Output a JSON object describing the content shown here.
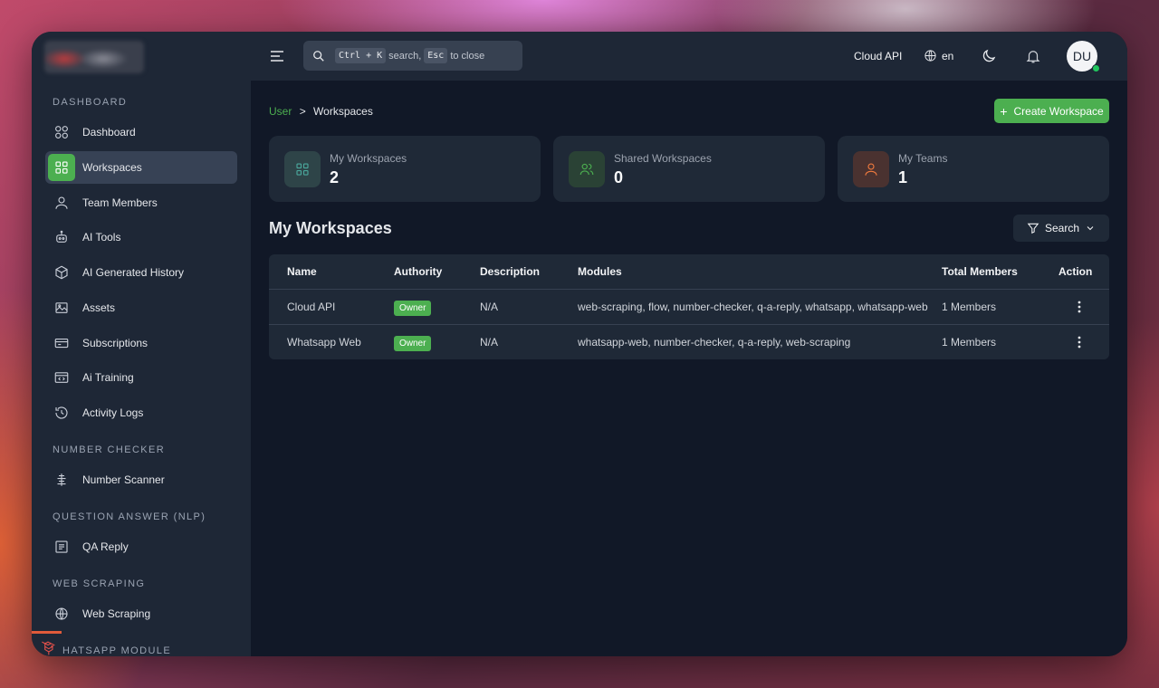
{
  "colors": {
    "accent": "#4caf50",
    "sidebar_bg": "#1e2736",
    "content_bg": "#111827",
    "card_bg": "#1f2937"
  },
  "sidebar": {
    "sections": [
      {
        "title": "DASHBOARD"
      },
      {
        "title": "NUMBER CHECKER"
      },
      {
        "title": "QUESTION ANSWER (NLP)"
      },
      {
        "title": "WEB SCRAPING"
      },
      {
        "title": "HATSAPP MODULE"
      }
    ],
    "items": [
      {
        "label": "Dashboard",
        "icon": "dashboard-icon"
      },
      {
        "label": "Workspaces",
        "icon": "grid-icon",
        "active": true
      },
      {
        "label": "Team Members",
        "icon": "user-icon"
      },
      {
        "label": "AI Tools",
        "icon": "robot-icon"
      },
      {
        "label": "AI Generated History",
        "icon": "cube-icon"
      },
      {
        "label": "Assets",
        "icon": "image-icon"
      },
      {
        "label": "Subscriptions",
        "icon": "card-icon"
      },
      {
        "label": "Ai Training",
        "icon": "code-window-icon"
      },
      {
        "label": "Activity Logs",
        "icon": "history-icon"
      },
      {
        "label": "Number Scanner",
        "icon": "scanner-icon"
      },
      {
        "label": "QA Reply",
        "icon": "document-icon"
      },
      {
        "label": "Web Scraping",
        "icon": "globe-icon"
      }
    ]
  },
  "topbar": {
    "search": {
      "kbd1": "Ctrl + K",
      "text1": "search,",
      "kbd2": "Esc",
      "text2": "to close"
    },
    "workspace": "Cloud API",
    "language": "en",
    "avatar_initials": "DU"
  },
  "breadcrumb": {
    "parent": "User",
    "separator": ">",
    "current": "Workspaces"
  },
  "create_button": {
    "plus": "+",
    "label": "Create Workspace"
  },
  "stats": [
    {
      "label": "My Workspaces",
      "value": "2",
      "icon": "grid-icon",
      "color": "#4aa89c"
    },
    {
      "label": "Shared Workspaces",
      "value": "0",
      "icon": "users-icon",
      "color": "#4caf50"
    },
    {
      "label": "My Teams",
      "value": "1",
      "icon": "user-icon",
      "color": "#f07a3e"
    }
  ],
  "workspaces_heading": "My Workspaces",
  "filter_button": {
    "label": "Search"
  },
  "table": {
    "headers": [
      "Name",
      "Authority",
      "Description",
      "Modules",
      "Total Members",
      "Action"
    ],
    "rows": [
      {
        "name": "Cloud API",
        "authority": "Owner",
        "description": "N/A",
        "modules": "web-scraping, flow, number-checker, q-a-reply, whatsapp, whatsapp-web",
        "members": "1 Members"
      },
      {
        "name": "Whatsapp Web",
        "authority": "Owner",
        "description": "N/A",
        "modules": "whatsapp-web, number-checker, q-a-reply, web-scraping",
        "members": "1 Members"
      }
    ]
  }
}
